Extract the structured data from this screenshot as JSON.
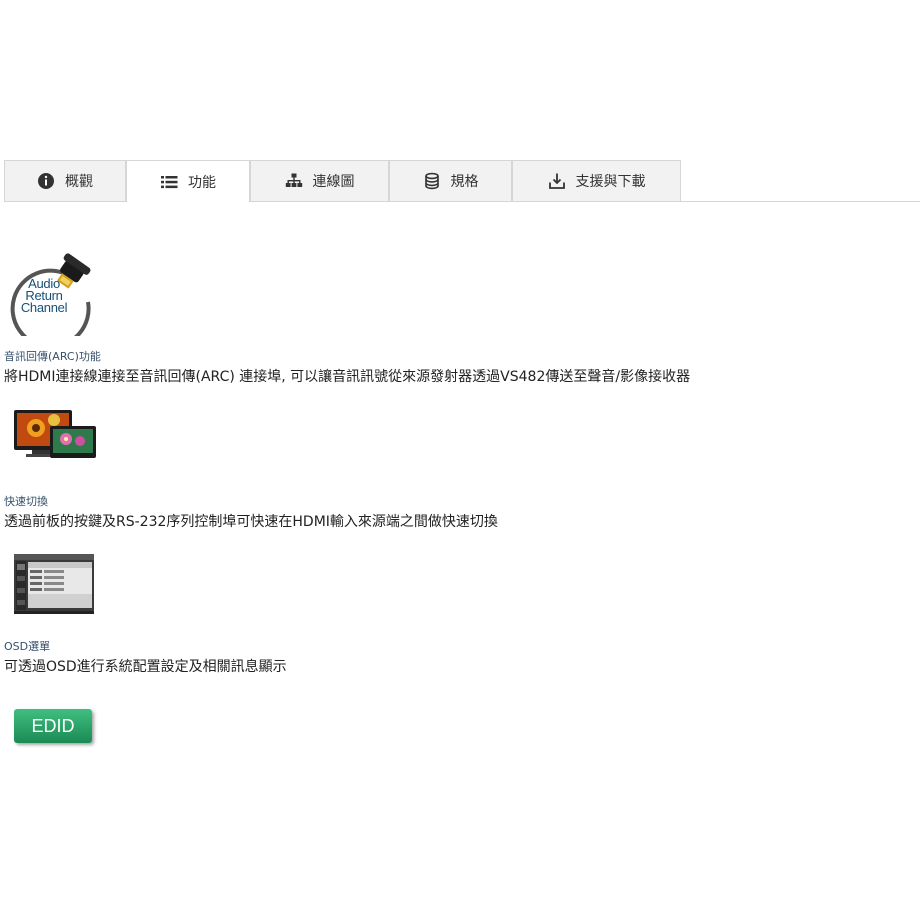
{
  "tabs": [
    {
      "label": "概觀",
      "icon": "info-icon",
      "active": false
    },
    {
      "label": "功能",
      "icon": "list-icon",
      "active": true
    },
    {
      "label": "連線圖",
      "icon": "sitemap-icon",
      "active": false
    },
    {
      "label": "規格",
      "icon": "database-icon",
      "active": false
    },
    {
      "label": "支援與下載",
      "icon": "download-icon",
      "active": false
    }
  ],
  "features": [
    {
      "image": "audio-return-channel-logo",
      "logo_text": [
        "Audio",
        "Return",
        "Channel"
      ],
      "title": "音訊回傳(ARC)功能",
      "desc": "將HDMI連接線連接至音訊回傳(ARC) 連接埠, 可以讓音訊訊號從來源發射器透過VS482傳送至聲音/影像接收器"
    },
    {
      "image": "quick-switching-monitors-image",
      "title": "快速切換",
      "desc": "透過前板的按鍵及RS-232序列控制埠可快速在HDMI輸入來源端之間做快速切換"
    },
    {
      "image": "osd-menu-screenshot",
      "title": "OSD選單",
      "desc": "可透過OSD進行系統配置設定及相關訊息顯示"
    }
  ],
  "edid": {
    "label": "EDID"
  },
  "colors": {
    "tab_bg": "#f2f2f2",
    "tab_border": "#d6d6d6",
    "title": "#35506b",
    "edid_green": "#1b8a55"
  }
}
